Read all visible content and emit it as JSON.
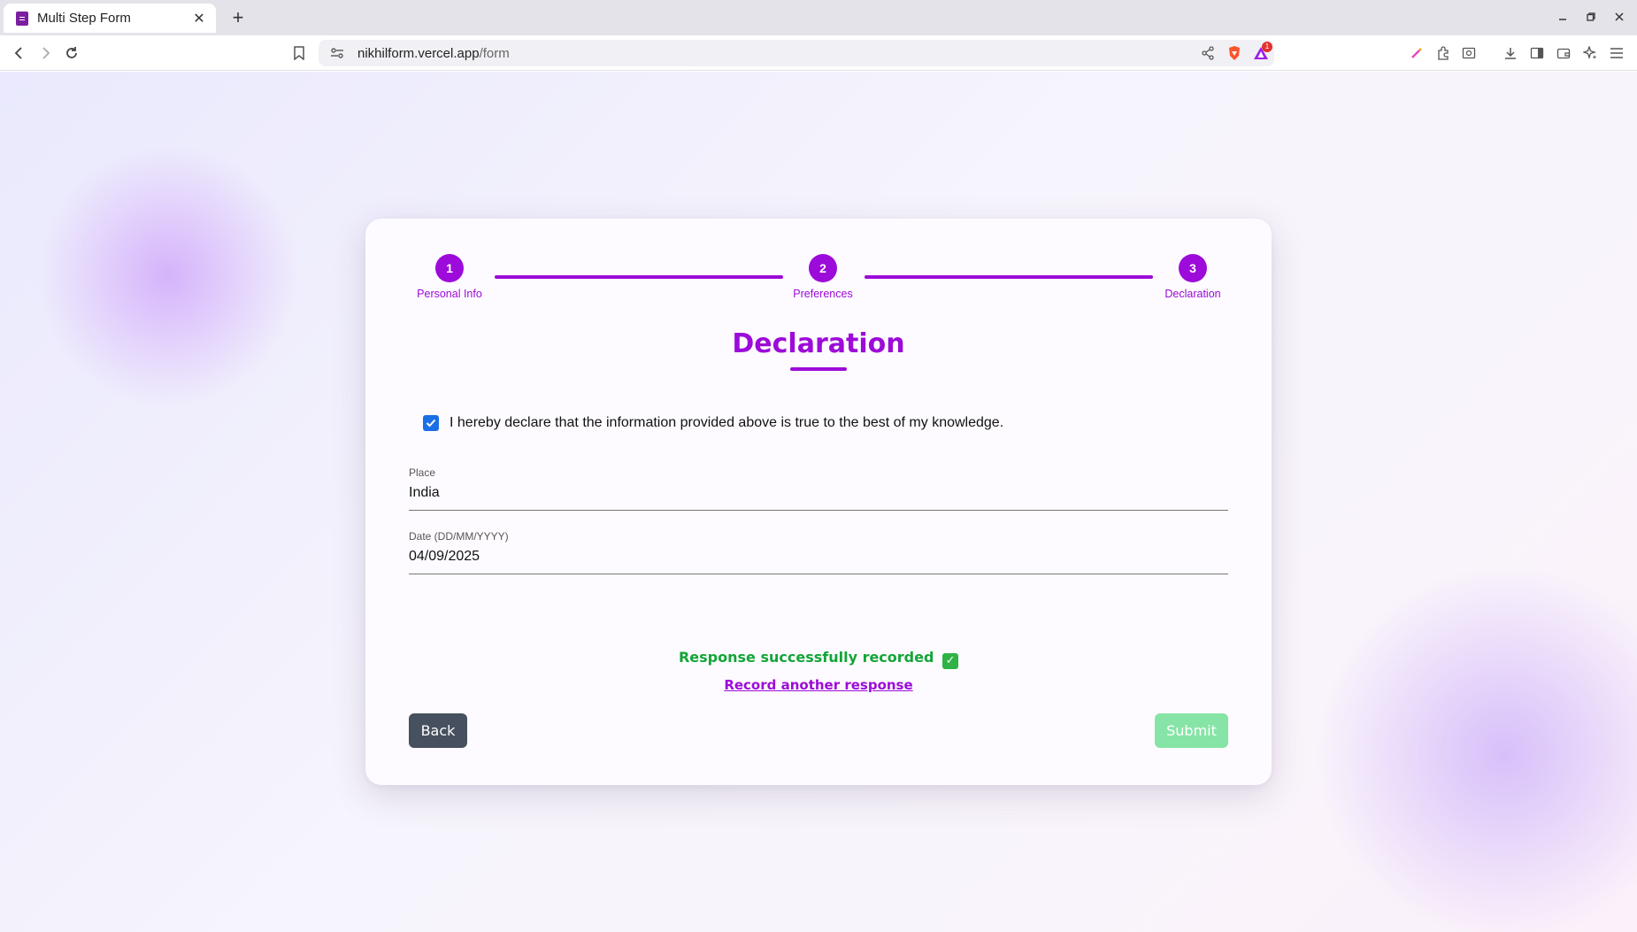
{
  "browser": {
    "tab_title": "Multi Step Form",
    "url_host": "nikhilform.vercel.app",
    "url_path": "/form",
    "notification_count": "1"
  },
  "stepper": {
    "steps": [
      {
        "number": "1",
        "label": "Personal Info"
      },
      {
        "number": "2",
        "label": "Preferences"
      },
      {
        "number": "3",
        "label": "Declaration"
      }
    ],
    "active_color": "#9c0bd9"
  },
  "form": {
    "heading": "Declaration",
    "declaration_text": "I hereby declare that the information provided above is true to the best of my knowledge.",
    "declaration_checked": true,
    "place_label": "Place",
    "place_value": "India",
    "date_label": "Date (DD/MM/YYYY)",
    "date_value": "04/09/2025",
    "success_message": "Response successfully recorded",
    "success_icon": "check-mark-emoji",
    "record_another": "Record another response",
    "back_label": "Back",
    "submit_label": "Submit"
  },
  "colors": {
    "accent": "#9c0bd9",
    "success": "#13a538",
    "back_button": "#46505f",
    "submit_button": "#86e4a6",
    "checkbox": "#1a6ee6"
  }
}
